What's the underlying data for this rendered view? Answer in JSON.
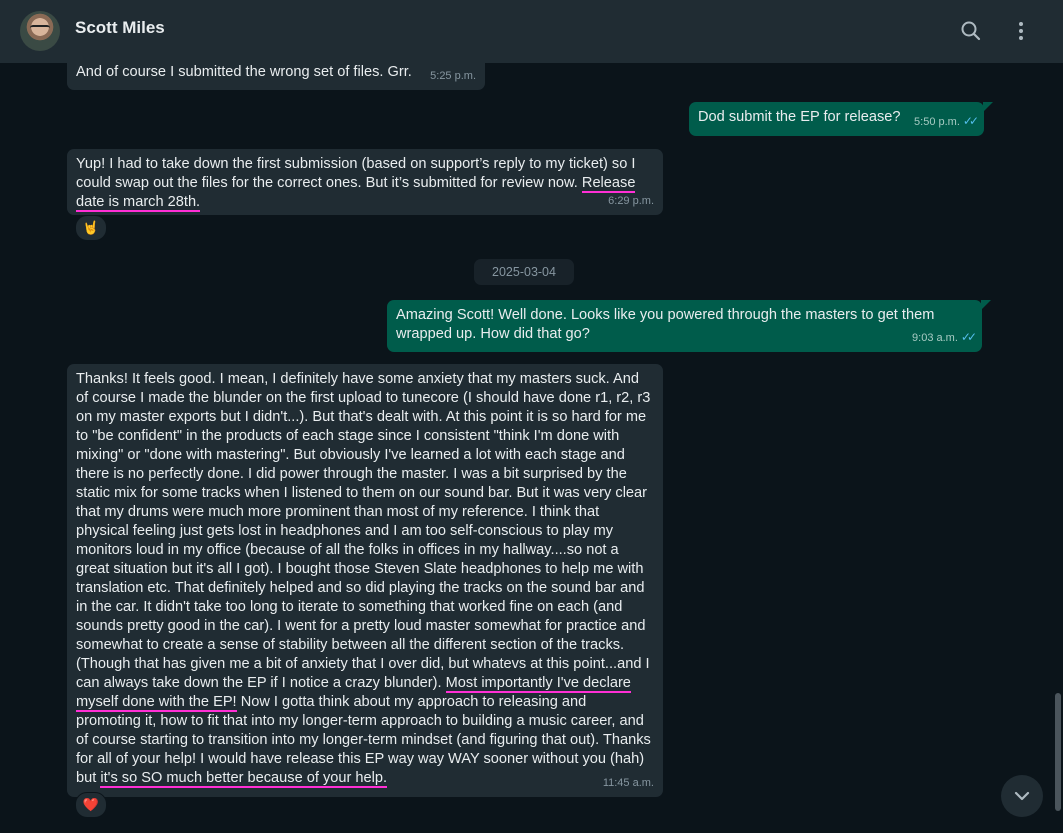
{
  "header": {
    "contact_name": "Scott Miles"
  },
  "messages": {
    "m1": {
      "text": "And of course I submitted the wrong set of files. Grr.",
      "time": "5:25 p.m."
    },
    "m2": {
      "text": "Dod submit the EP for release?",
      "time": "5:50 p.m."
    },
    "m3": {
      "text_a": "Yup! I had to take down the first submission (based on support’s reply to my ticket) so I could swap out the files for the correct ones. But it’s submitted for review now.",
      "text_mark": "Release date is march 28th.",
      "time": "6:29 p.m.",
      "reaction": "🤘"
    },
    "date_separator": "2025-03-04",
    "m4": {
      "text": "Amazing Scott! Well done. Looks like you powered through the masters to get them wrapped up. How did that go?",
      "time": "9:03 a.m."
    },
    "m5": {
      "text_a": "Thanks! It feels good. I mean, I definitely have some anxiety that my masters suck. And of course I made the blunder on the first upload to tunecore (I should have done r1, r2, r3 on my master exports but I didn't...). But that's dealt with. At this point it is so hard for me to \"be confident\" in the products of each stage since I consistent \"think I'm done with mixing\" or \"done with mastering\". But obviously I've learned a lot with each stage and there is no perfectly done. I did power through the master. I was a bit surprised by the static mix for some tracks when I listened to them on our sound bar. But it was very clear that my drums were much more prominent than most of my reference. I think that physical feeling just gets lost in headphones and I am too self-conscious to play my monitors loud in my office (because of all the folks in offices in my hallway....so not a great situation but it's all I got). I bought those Steven Slate headphones to help me with translation etc. That definitely helped and so did playing the tracks on the sound bar and in the car. It didn't take too long to iterate to something that worked fine on each (and sounds pretty good in the car). I went for a pretty loud master somewhat for practice and somewhat to create a sense of stability between all the different section of the tracks. (Though that has given me a bit of anxiety that I over did, but whatevs at this point...and I can always take down the EP if I notice a crazy blunder).",
      "text_mark1": "Most importantly I've declare myself done with the EP!",
      "text_b": "Now I gotta think about my approach to releasing and promoting it, how to fit that into my longer-term approach to building a music career, and of course starting to transition into my longer-term mindset (and figuring that out). Thanks for all of your help! I would have release this EP way way WAY sooner without you (hah) but",
      "text_mark2": "it's so SO much better because of your help.",
      "time": "11:45 a.m.",
      "reaction": "❤️"
    }
  },
  "colors": {
    "background": "#0b141a",
    "incoming": "#202c33",
    "outgoing": "#005c4b",
    "highlight": "#ff2fd5",
    "read_check": "#53bdeb"
  },
  "icons": [
    "search-icon",
    "menu-dots-icon",
    "double-check-icon",
    "chevron-down-icon"
  ]
}
